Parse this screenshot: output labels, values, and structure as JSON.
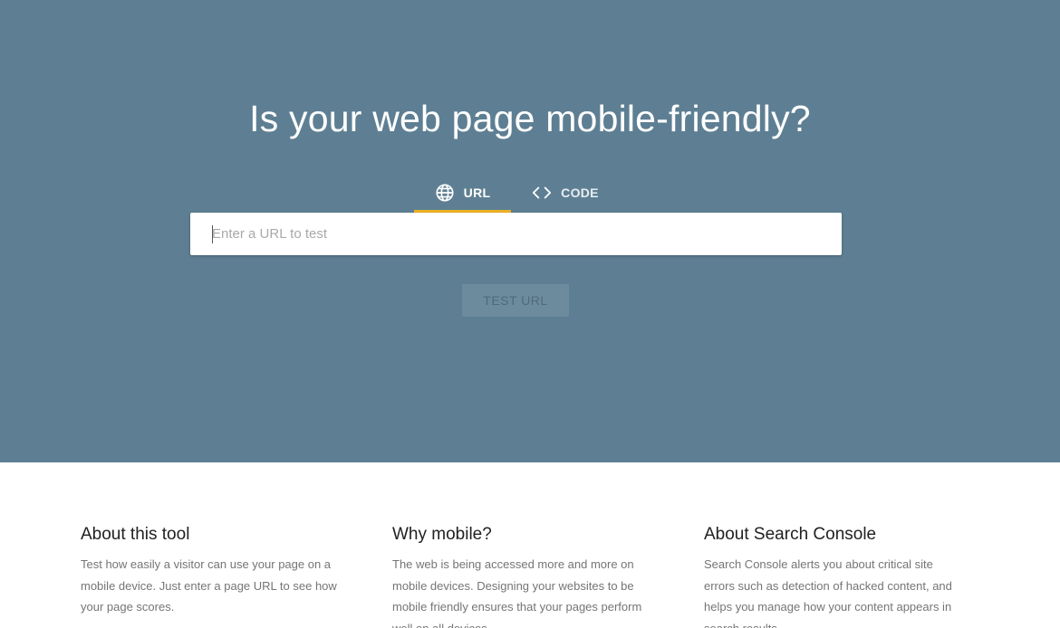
{
  "hero": {
    "title": "Is your web page mobile-friendly?",
    "background_color": "#5e7f93"
  },
  "tabs": [
    {
      "label": "URL",
      "icon": "globe-icon",
      "active": true
    },
    {
      "label": "CODE",
      "icon": "code-brackets-icon",
      "active": false
    }
  ],
  "url_input": {
    "placeholder": "Enter a URL to test",
    "value": ""
  },
  "test_button": {
    "label": "TEST URL",
    "enabled": false
  },
  "accent_color": "#f0b323",
  "info_sections": [
    {
      "heading": "About this tool",
      "body": "Test how easily a visitor can use your page on a mobile device. Just enter a page URL to see how your page scores."
    },
    {
      "heading": "Why mobile?",
      "body": "The web is being accessed more and more on mobile devices. Designing your websites to be mobile friendly ensures that your pages perform well on all devices."
    },
    {
      "heading": "About Search Console",
      "body": "Search Console alerts you about critical site errors such as detection of hacked content, and helps you manage how your content appears in search results."
    }
  ]
}
